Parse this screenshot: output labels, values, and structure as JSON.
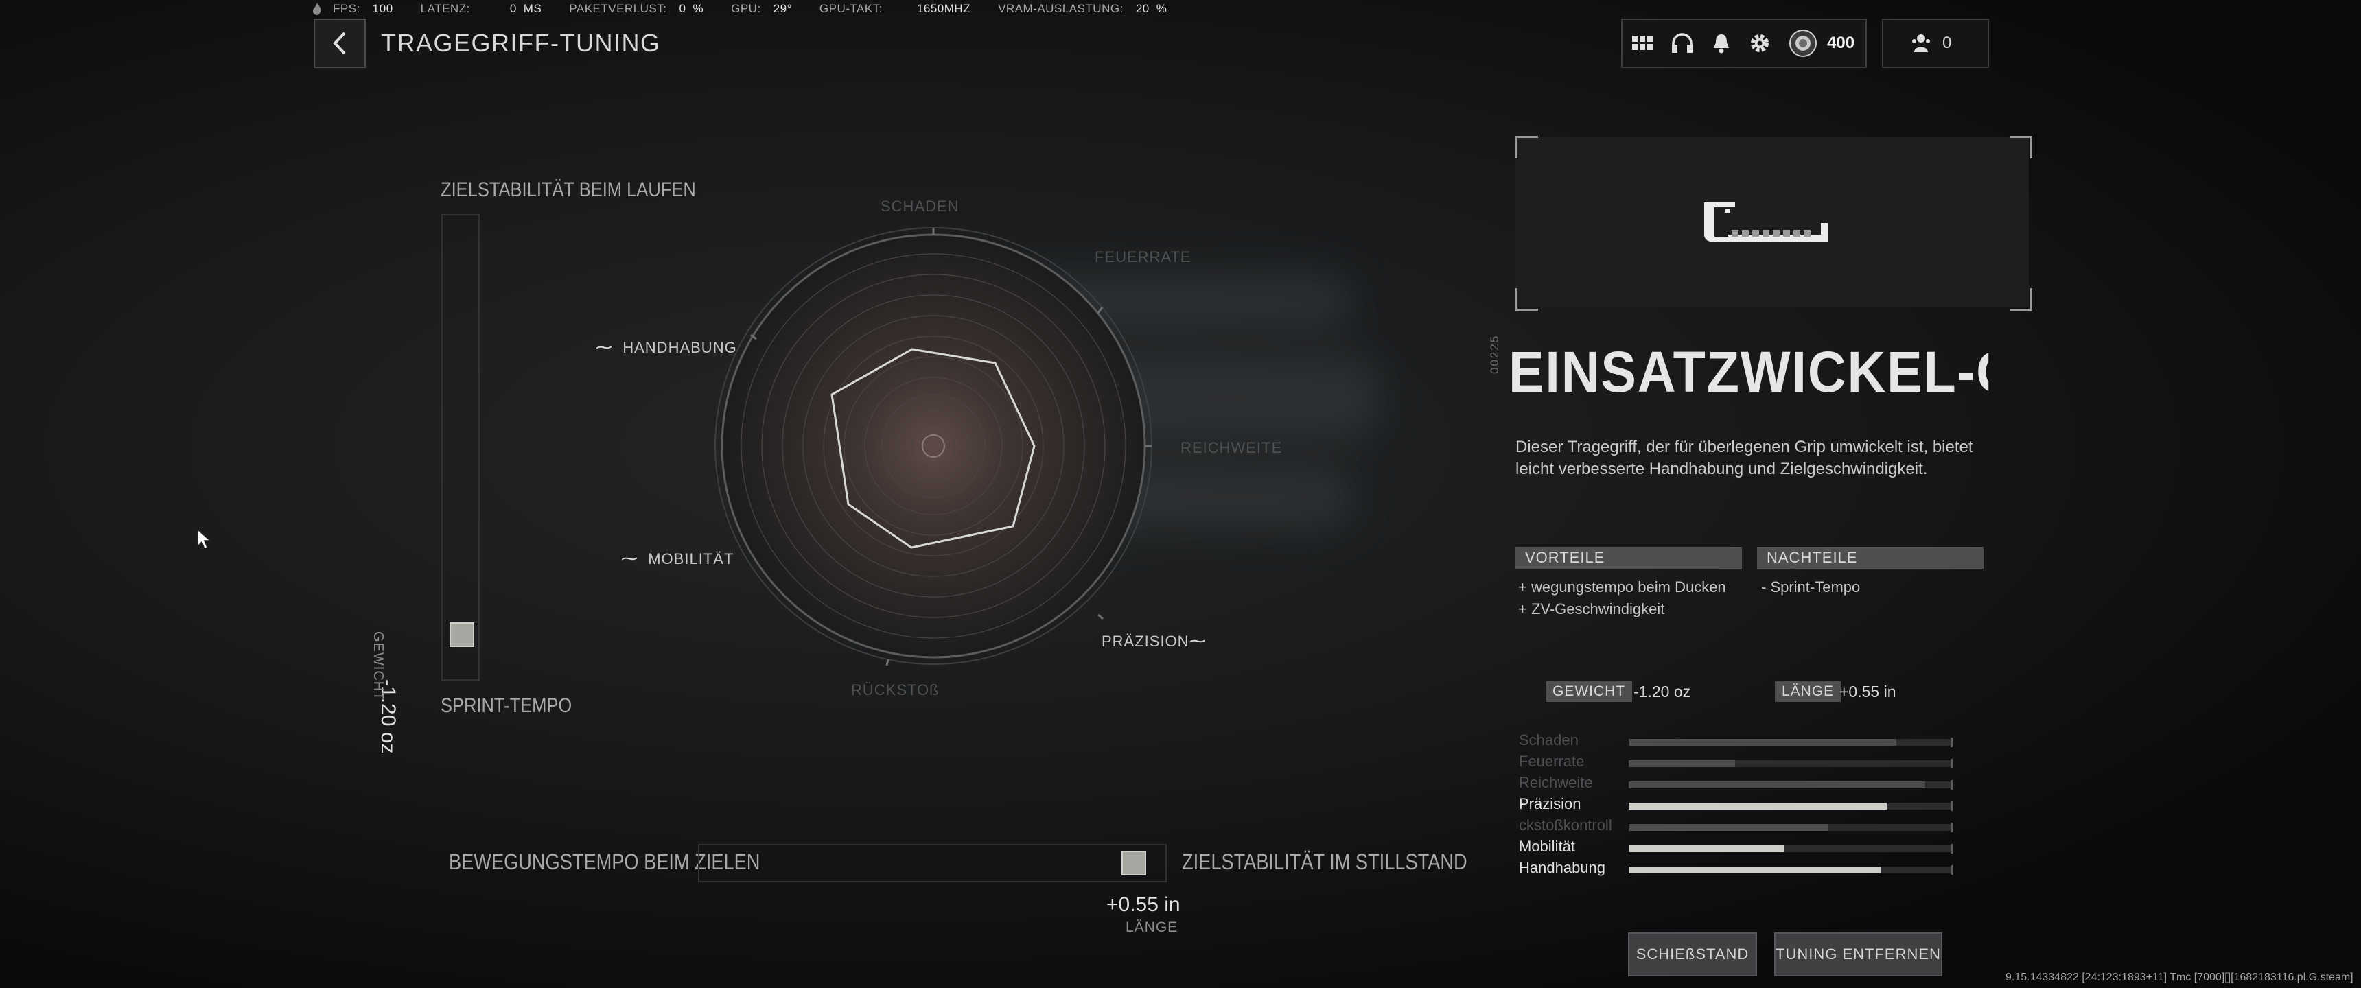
{
  "perf": {
    "fps_label": "FPS:",
    "fps": "100",
    "latency_label": "LATENZ:",
    "latency": "0",
    "latency_unit": "MS",
    "packetloss_label": "PAKETVERLUST:",
    "packetloss": "0",
    "packetloss_unit": "%",
    "gpu_label": "GPU:",
    "gpu": "29°",
    "gpuclock_label": "GPU-TAKT:",
    "gpuclock": "1650MHZ",
    "vram_label": "VRAM-AUSLASTUNG:",
    "vram": "20",
    "vram_unit": "%"
  },
  "header": {
    "title": "TRAGEGRIFF-TUNING"
  },
  "topbar": {
    "currency": "400",
    "party_count": "0"
  },
  "vslider": {
    "top_label": "ZIELSTABILITÄT BEIM LAUFEN",
    "bottom_label": "SPRINT-TEMPO",
    "value": "-1.20 oz",
    "unit_label": "GEWICHT",
    "position": 0.93
  },
  "radar": {
    "labels": {
      "schaden": "SCHADEN",
      "feuerrate": "FEUERRATE",
      "reichweite": "REICHWEITE",
      "praezision": "PRÄZISION",
      "rueckstoss": "RÜCKSTOß",
      "mobilitaet": "MOBILITÄT",
      "handhabung": "HANDHABUNG"
    }
  },
  "hslider": {
    "left_label": "BEWEGUNGSTEMPO BEIM ZIELEN",
    "right_label": "ZIELSTABILITÄT IM STILLSTAND",
    "value": "+0.55 in",
    "unit_label": "LÄNGE",
    "position": 0.96
  },
  "item": {
    "code": "00225",
    "name": "EINSATZWICKEL-GRIFF",
    "description": "Dieser Tragegriff, der für überlegenen Grip umwickelt ist, bietet leicht verbesserte Handhabung und Zielgeschwindigkeit."
  },
  "pros_cons": {
    "pros_label": "VORTEILE",
    "cons_label": "NACHTEILE",
    "pros": [
      "+ wegungstempo beim Ducken",
      "+ ZV-Geschwindigkeit"
    ],
    "cons": [
      "-  Sprint-Tempo"
    ]
  },
  "tuning": {
    "weight_label": "GEWICHT",
    "weight_value": "-1.20  oz",
    "length_label": "LÄNGE",
    "length_value": "+0.55  in"
  },
  "stats": [
    {
      "name": "Schaden",
      "value": 0.83,
      "active": false
    },
    {
      "name": "Feuerrate",
      "value": 0.33,
      "active": false
    },
    {
      "name": "Reichweite",
      "value": 0.92,
      "active": false
    },
    {
      "name": "Präzision",
      "value": 0.8,
      "active": true
    },
    {
      "name": "ckstoßkontroll",
      "value": 0.62,
      "active": false
    },
    {
      "name": "Mobilität",
      "value": 0.48,
      "active": true
    },
    {
      "name": "Handhabung",
      "value": 0.78,
      "active": true
    }
  ],
  "buttons": {
    "range": "SCHIEßSTAND",
    "remove": "TUNING ENTFERNEN"
  },
  "build": "9.15.14334822 [24:123:1893+11] Tmc [7000][][1682183116.pl.G.steam]",
  "colors": {
    "bar_active": "#cfcfca",
    "bar_inactive": "#4a4c4e",
    "accent": "#4e4f51"
  }
}
